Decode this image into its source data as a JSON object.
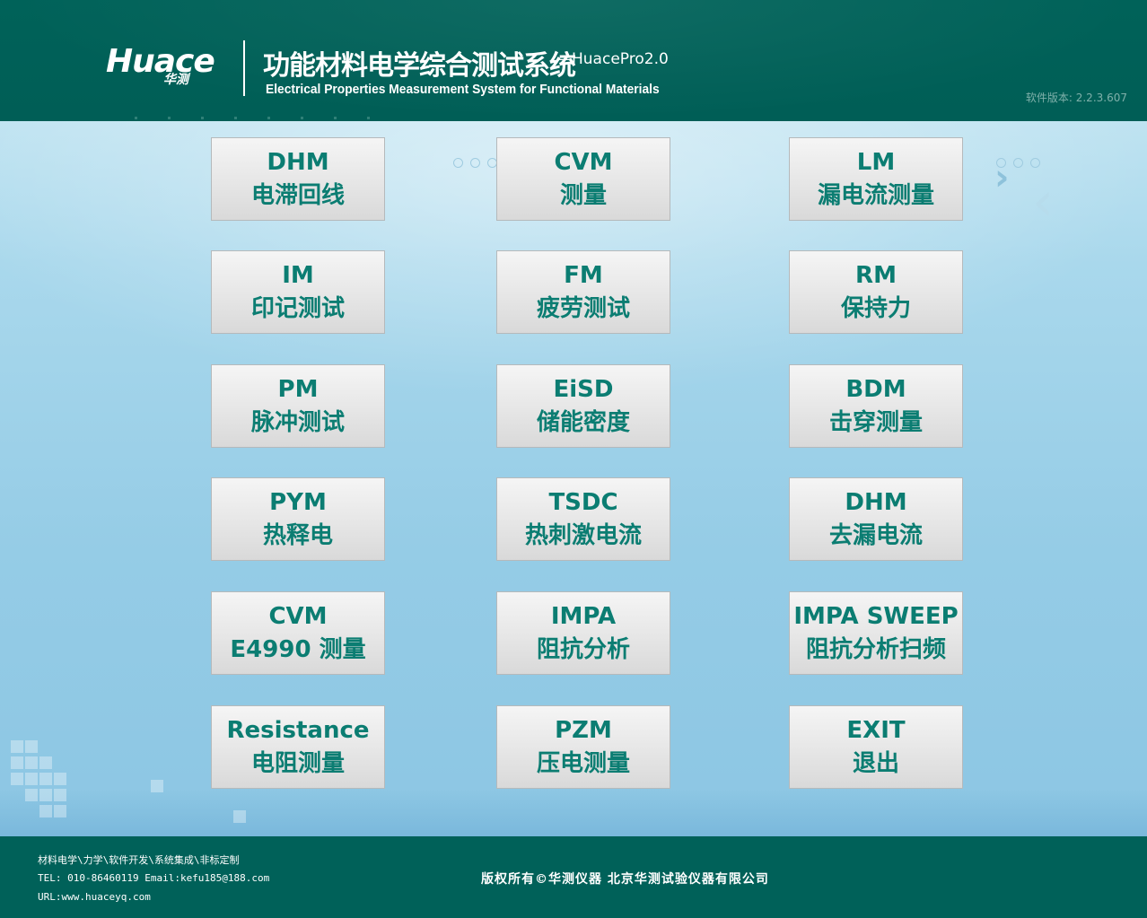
{
  "header": {
    "logo_text": "Huace",
    "logo_sub": "华测",
    "title_cn": "功能材料电学综合测试系统",
    "title_suffix": "—HuacePro2.0",
    "title_en": "Electrical Properties Measurement System for Functional Materials",
    "version": "软件版本: 2.2.3.607"
  },
  "tiles": [
    {
      "code": "DHM",
      "label": "电滞回线"
    },
    {
      "code": "CVM",
      "label": "测量"
    },
    {
      "code": "LM",
      "label": "漏电流测量"
    },
    {
      "code": "IM",
      "label": "印记测试"
    },
    {
      "code": "FM",
      "label": "疲劳测试"
    },
    {
      "code": "RM",
      "label": "保持力"
    },
    {
      "code": "PM",
      "label": "脉冲测试"
    },
    {
      "code": "EiSD",
      "label": "储能密度"
    },
    {
      "code": "BDM",
      "label": "击穿测量"
    },
    {
      "code": "PYM",
      "label": "热释电"
    },
    {
      "code": "TSDC",
      "label": "热刺激电流"
    },
    {
      "code": "DHM",
      "label": "去漏电流"
    },
    {
      "code": "CVM",
      "label": "E4990 测量"
    },
    {
      "code": "IMPA",
      "label": "阻抗分析"
    },
    {
      "code": "IMPA SWEEP",
      "label": "阻抗分析扫频"
    },
    {
      "code": "Resistance",
      "label": "电阻测量"
    },
    {
      "code": "PZM",
      "label": "压电测量"
    },
    {
      "code": "EXIT",
      "label": "退出"
    }
  ],
  "footer": {
    "line1": "材料电学\\力学\\软件开发\\系统集成\\非标定制",
    "line2": "TEL: 010-86460119  Email:kefu185@188.com",
    "line3": "URL:www.huaceyq.com",
    "copyright": "版权所有©华测仪器 北京华测试验仪器有限公司"
  }
}
